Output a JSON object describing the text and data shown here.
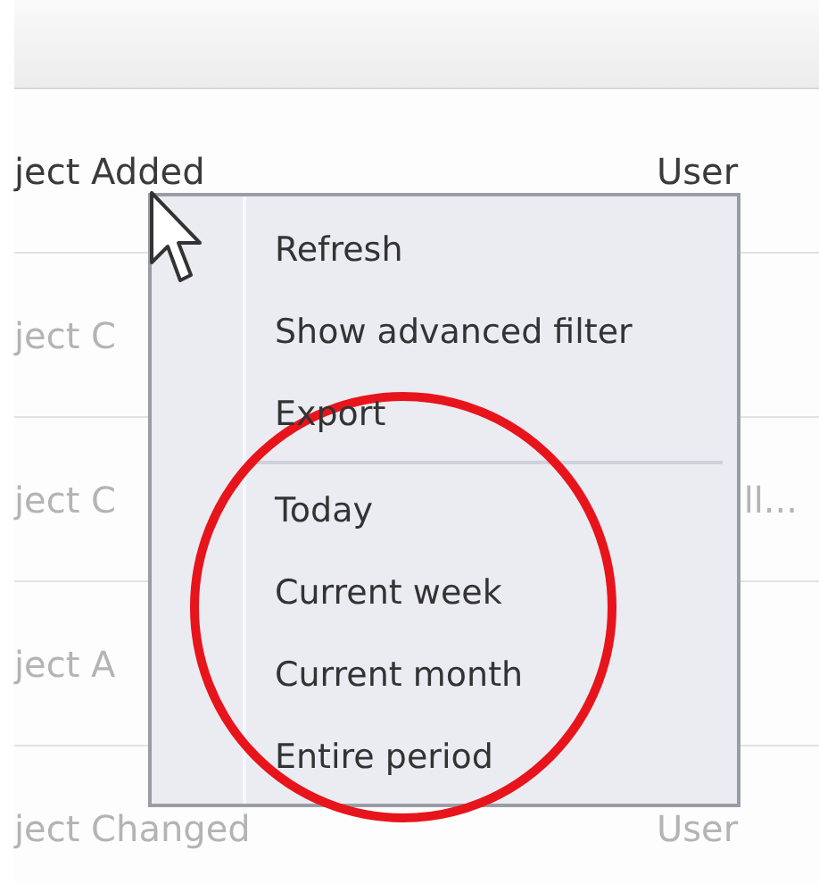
{
  "table": {
    "rows": [
      {
        "column_1": "ject Added",
        "column_2": "User",
        "faded": false
      },
      {
        "column_1": "ject C",
        "column_2": "",
        "faded": true
      },
      {
        "column_1": "ject C",
        "column_2": "ll...",
        "faded": true,
        "column_2_covered": true
      },
      {
        "column_1": "ject A",
        "column_2": "",
        "faded": true
      },
      {
        "column_1": "ject Changed",
        "column_2": "User",
        "faded": true
      }
    ]
  },
  "context_menu": {
    "items": [
      {
        "kind": "item",
        "label": "Refresh"
      },
      {
        "kind": "item",
        "label": "Show advanced filter"
      },
      {
        "kind": "item",
        "label": "Export"
      },
      {
        "kind": "separator"
      },
      {
        "kind": "item",
        "label": "Today"
      },
      {
        "kind": "item",
        "label": "Current week"
      },
      {
        "kind": "item",
        "label": "Current month"
      },
      {
        "kind": "item",
        "label": "Entire period"
      }
    ]
  }
}
